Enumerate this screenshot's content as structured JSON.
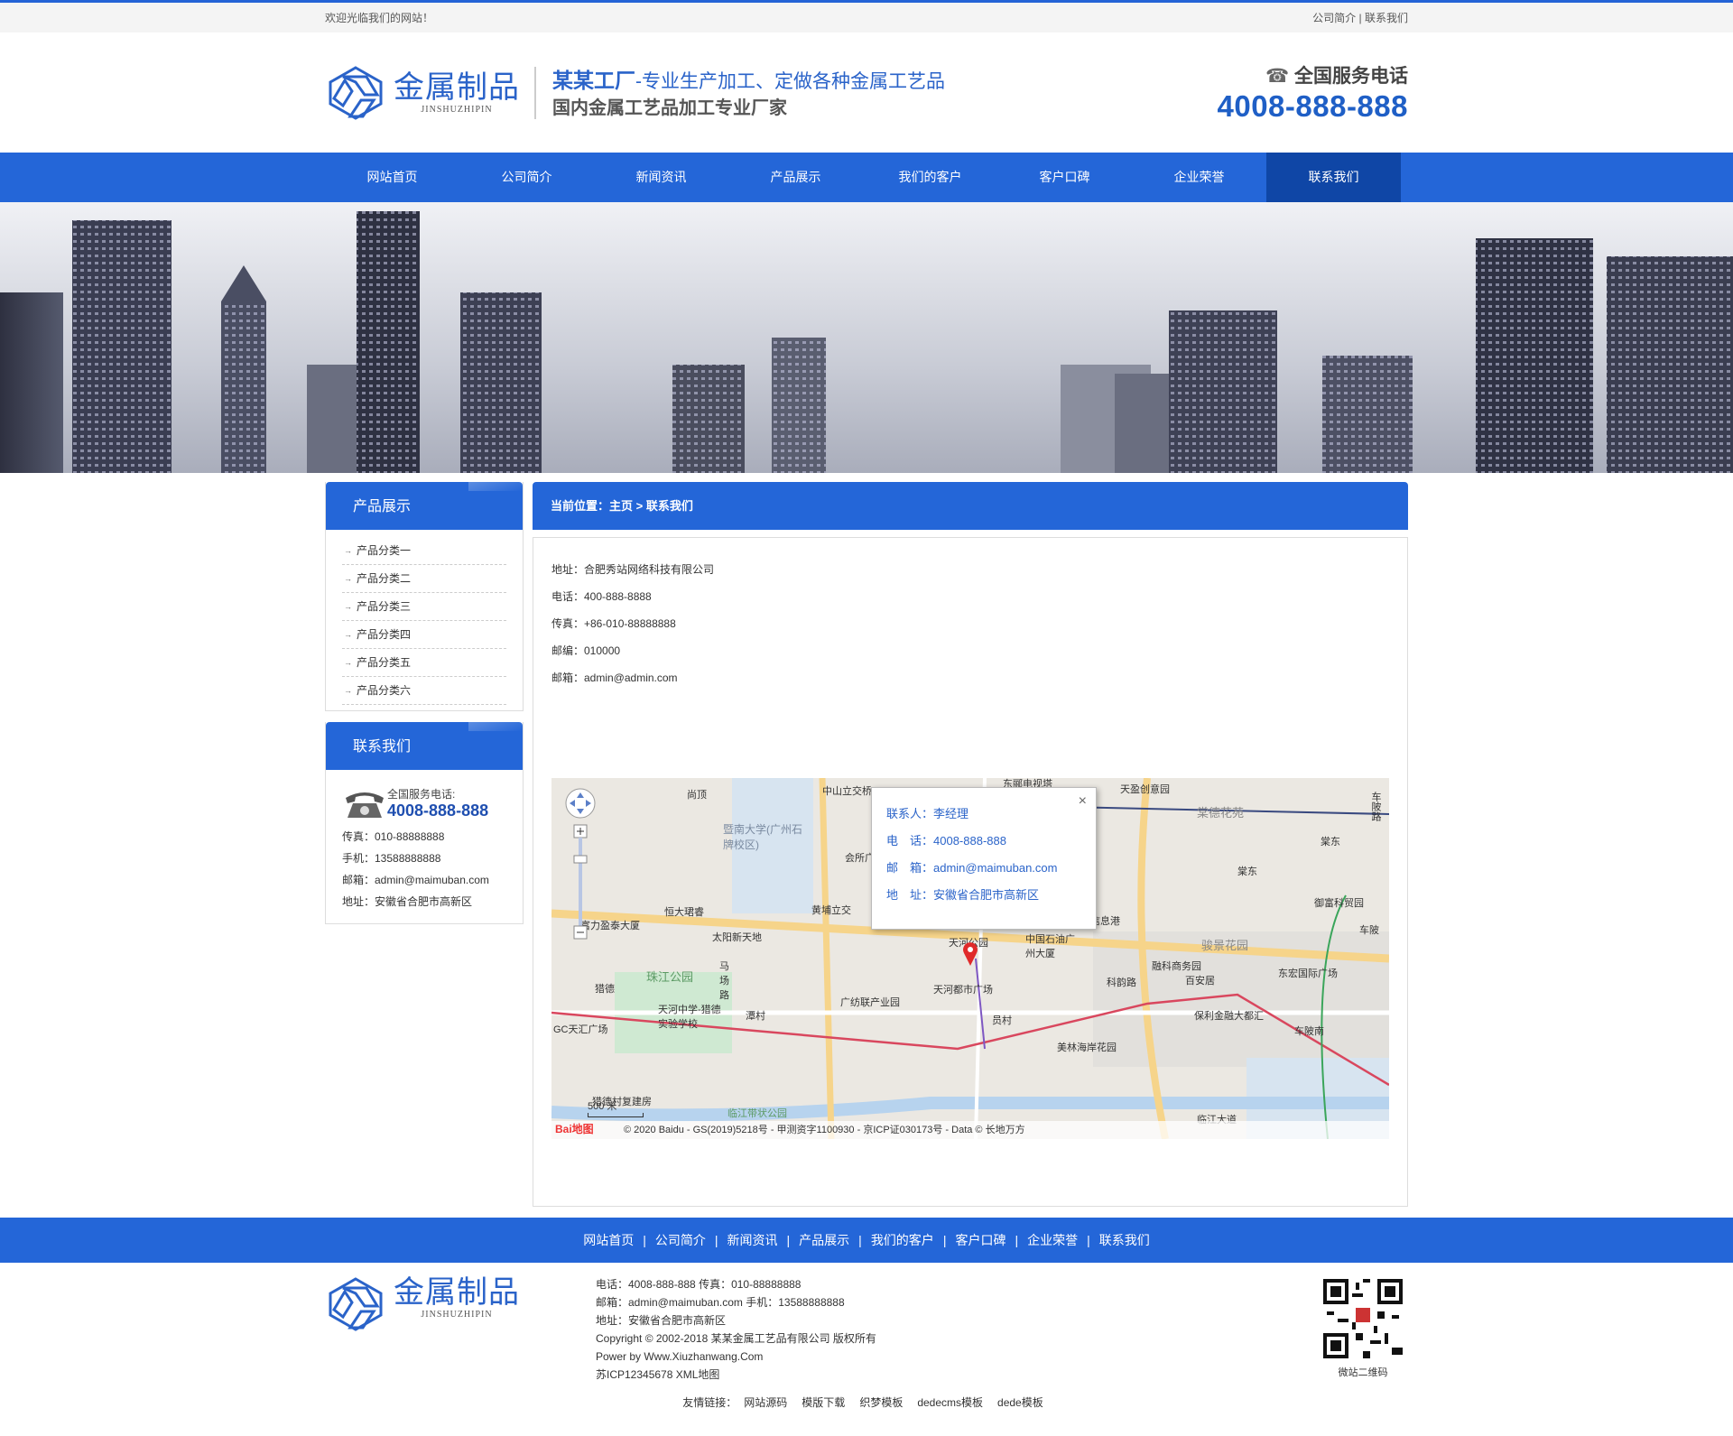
{
  "topbar": {
    "welcome": "欢迎光临我们的网站！",
    "link1": "公司简介",
    "sep": " | ",
    "link2": "联系我们"
  },
  "header": {
    "logo_cn": "金属制品",
    "logo_en": "JINSHUZHIPIN",
    "slogan_brand": "某某工厂",
    "slogan_rest": "-专业生产加工、定做各种金属工艺品",
    "slogan_line2": "国内金属工艺品加工专业厂家",
    "hotline_title": "全国服务电话",
    "hotline_number": "4008-888-888"
  },
  "nav": [
    "网站首页",
    "公司简介",
    "新闻资讯",
    "产品展示",
    "我们的客户",
    "客户口碑",
    "企业荣誉",
    "联系我们"
  ],
  "sidebar": {
    "products_title": "产品展示",
    "categories": [
      "产品分类一",
      "产品分类二",
      "产品分类三",
      "产品分类四",
      "产品分类五",
      "产品分类六"
    ],
    "contact_title": "联系我们",
    "phone_label": "全国服务电话:",
    "phone_number": "4008-888-888",
    "fax": "传真：010-88888888",
    "mobile": "手机：13588888888",
    "email": "邮箱：admin@maimuban.com",
    "address": "地址：安徽省合肥市高新区"
  },
  "content": {
    "breadcrumb": "当前位置：主页 > 联系我们",
    "lines": [
      "地址：合肥秀站网络科技有限公司",
      "电话：400-888-8888",
      "传真：+86-010-88888888",
      "邮编：010000",
      "邮箱：admin@admin.com"
    ]
  },
  "map": {
    "popup_contact": "联系人：李经理",
    "popup_phone": "电　话：4008-888-888",
    "popup_email": "邮　箱：admin@maimuban.com",
    "popup_address": "地　址：安徽省合肥市高新区",
    "close": "×",
    "scale": "500 米",
    "logo": "Bai地图",
    "copyright": "© 2020 Baidu - GS(2019)5218号 - 甲测资字1100930 - 京ICP证030173号 - Data © 长地万方",
    "labels": [
      "尚顶",
      "中山立交桥",
      "东郦电视塔",
      "天盈创意园",
      "棠德花苑",
      "车陂路",
      "暨南大学(广州石牌校区)",
      "会所广场",
      "棠东",
      "棠东",
      "黄埔立交",
      "天河公园",
      "中国石油广州大厦",
      "广州信息港",
      "御富科贸园",
      "车陂",
      "富力盈泰大厦",
      "恒大珺睿",
      "太阳新天地",
      "骏景花园",
      "融科商务园",
      "东宏国际广场",
      "珠江公园",
      "马场路",
      "猎德",
      "天河都市广场",
      "科韵路",
      "百安居",
      "天河中学-猎德实验学校",
      "潭村",
      "广纺联产业园",
      "员村",
      "保利金融大都汇",
      "车陂南",
      "GC天汇广场",
      "美林海岸花园",
      "猎德村复建房",
      "临江带状公园",
      "临江大道"
    ]
  },
  "footer": {
    "nav": [
      "网站首页",
      "公司简介",
      "新闻资讯",
      "产品展示",
      "我们的客户",
      "客户口碑",
      "企业荣誉",
      "联系我们"
    ],
    "sep": "|",
    "logo_cn": "金属制品",
    "logo_en": "JINSHUZHIPIN",
    "info": [
      "电话：4008-888-888 传真：010-88888888",
      "邮箱：admin@maimuban.com 手机：13588888888",
      "地址：安徽省合肥市高新区",
      "Copyright © 2002-2018 某某金属工艺品有限公司 版权所有",
      "Power by Www.Xiuzhanwang.Com",
      "苏ICP12345678 XML地图"
    ],
    "qr_label": "微站二维码",
    "friend_label": "友情链接：",
    "friend_links": [
      "网站源码",
      "模版下载",
      "织梦模板",
      "dedecms模板",
      "dede模板"
    ]
  },
  "colors": {
    "primary": "#2466d8",
    "nav_active": "#0f46a6",
    "accent_text": "#2a63c9"
  },
  "icons": [
    "logo-mark-icon",
    "phone-icon",
    "telephone-icon",
    "zoom-control-icon",
    "map-marker-icon",
    "qr-code-icon"
  ]
}
